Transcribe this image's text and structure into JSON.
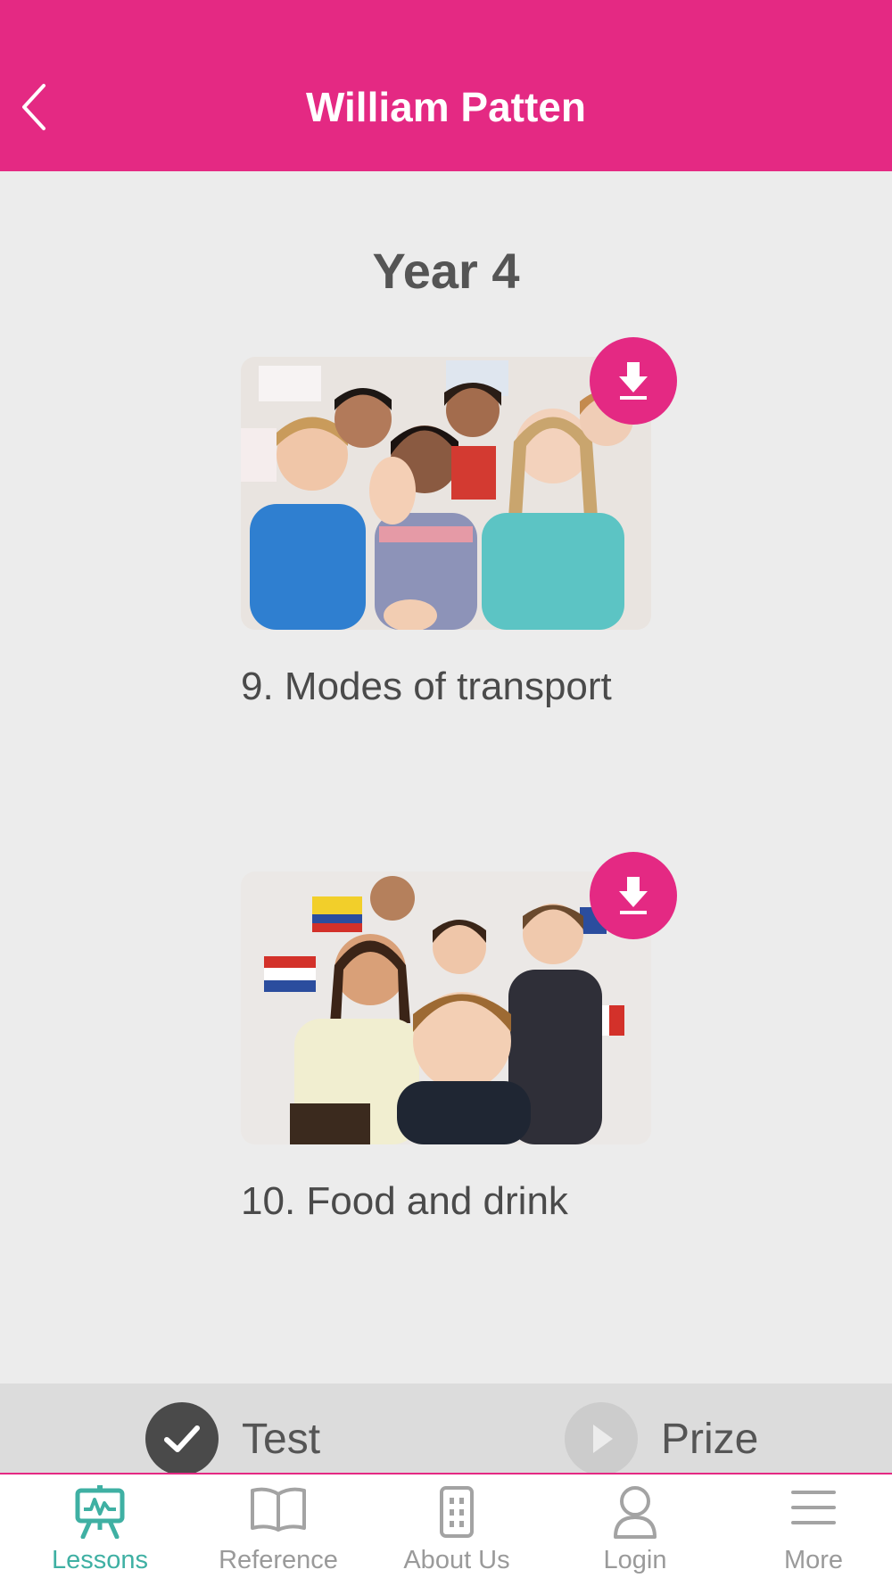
{
  "header": {
    "title": "William Patten"
  },
  "section": {
    "title": "Year 4"
  },
  "lessons": [
    {
      "title": "9. Modes of transport"
    },
    {
      "title": "10. Food and drink"
    }
  ],
  "actions": {
    "test_label": "Test",
    "prize_label": "Prize"
  },
  "tabs": [
    {
      "label": "Lessons",
      "icon": "easel-chart-icon",
      "active": true
    },
    {
      "label": "Reference",
      "icon": "book-icon",
      "active": false
    },
    {
      "label": "About Us",
      "icon": "building-icon",
      "active": false
    },
    {
      "label": "Login",
      "icon": "person-icon",
      "active": false
    },
    {
      "label": "More",
      "icon": "hamburger-menu-icon",
      "active": false
    }
  ],
  "colors": {
    "brand": "#e42983",
    "active_tab": "#3fb0a3",
    "background": "#ececec"
  }
}
